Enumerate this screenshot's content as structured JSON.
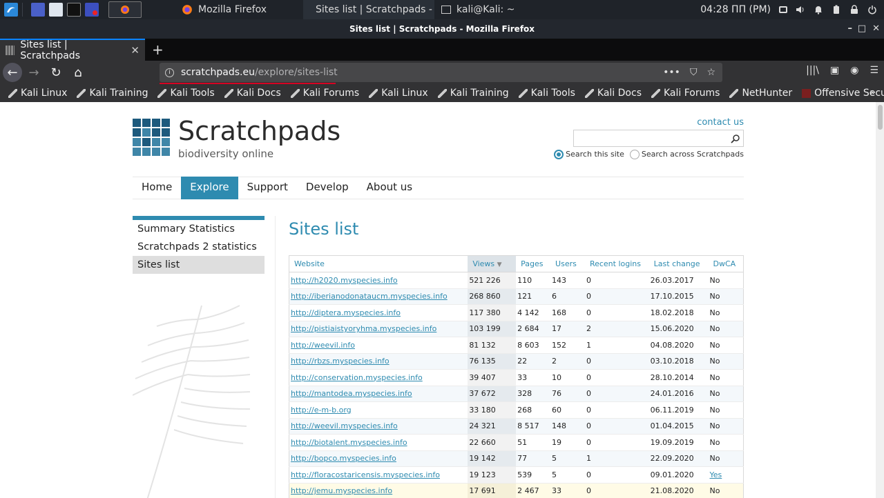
{
  "taskbar": {
    "tasks": [
      {
        "label": "Mozilla Firefox"
      },
      {
        "label": "Sites list | Scratchpads - ..."
      },
      {
        "label": "kali@Kali: ~"
      }
    ],
    "clock": "04:28 ΠΠ (PM)"
  },
  "window": {
    "title": "Sites list | Scratchpads - Mozilla Firefox"
  },
  "browser": {
    "tab_title": "Sites list | Scratchpads",
    "url_host": "scratchpads.eu",
    "url_path": "/explore/sites-list",
    "bookmarks": [
      "Kali Linux",
      "Kali Training",
      "Kali Tools",
      "Kali Docs",
      "Kali Forums",
      "Kali Linux",
      "Kali Training",
      "Kali Tools",
      "Kali Docs",
      "Kali Forums",
      "NetHunter",
      "Offensive Security"
    ]
  },
  "site": {
    "logo_title": "Scratchpads",
    "logo_subtitle": "biodiversity online",
    "contact": "contact us",
    "search_this_site": "Search this site",
    "search_across": "Search across Scratchpads",
    "nav": [
      "Home",
      "Explore",
      "Support",
      "Develop",
      "About us"
    ],
    "sidebar": [
      "Summary Statistics",
      "Scratchpads 2 statistics",
      "Sites list"
    ],
    "page_title": "Sites list"
  },
  "table": {
    "headers": [
      "Website",
      "Views",
      "Pages",
      "Users",
      "Recent logins",
      "Last change",
      "DwCA"
    ],
    "rows": [
      [
        "http://h2020.myspecies.info",
        "521 226",
        "110",
        "143",
        "0",
        "26.03.2017",
        "No"
      ],
      [
        "http://iberianodonataucm.myspecies.info",
        "268 860",
        "121",
        "6",
        "0",
        "17.10.2015",
        "No"
      ],
      [
        "http://diptera.myspecies.info",
        "117 380",
        "4 142",
        "168",
        "0",
        "18.02.2018",
        "No"
      ],
      [
        "http://pistiaistyoryhma.myspecies.info",
        "103 199",
        "2 684",
        "17",
        "2",
        "15.06.2020",
        "No"
      ],
      [
        "http://weevil.info",
        "81 132",
        "8 603",
        "152",
        "1",
        "04.08.2020",
        "No"
      ],
      [
        "http://rbzs.myspecies.info",
        "76 135",
        "22",
        "2",
        "0",
        "03.10.2018",
        "No"
      ],
      [
        "http://conservation.myspecies.info",
        "39 407",
        "33",
        "10",
        "0",
        "28.10.2014",
        "No"
      ],
      [
        "http://mantodea.myspecies.info",
        "37 672",
        "328",
        "76",
        "0",
        "24.01.2016",
        "No"
      ],
      [
        "http://e-m-b.org",
        "33 180",
        "268",
        "60",
        "0",
        "06.11.2019",
        "No"
      ],
      [
        "http://weevil.myspecies.info",
        "24 321",
        "8 517",
        "148",
        "0",
        "01.04.2015",
        "No"
      ],
      [
        "http://biotalent.myspecies.info",
        "22 660",
        "51",
        "19",
        "0",
        "19.09.2019",
        "No"
      ],
      [
        "http://bopco.myspecies.info",
        "19 142",
        "77",
        "5",
        "1",
        "22.09.2020",
        "No"
      ],
      [
        "http://floracostaricensis.myspecies.info",
        "19 123",
        "539",
        "5",
        "0",
        "09.01.2020",
        "Yes"
      ],
      [
        "http://jemu.myspecies.info",
        "17 691",
        "2 467",
        "33",
        "0",
        "21.08.2020",
        "No"
      ]
    ]
  }
}
